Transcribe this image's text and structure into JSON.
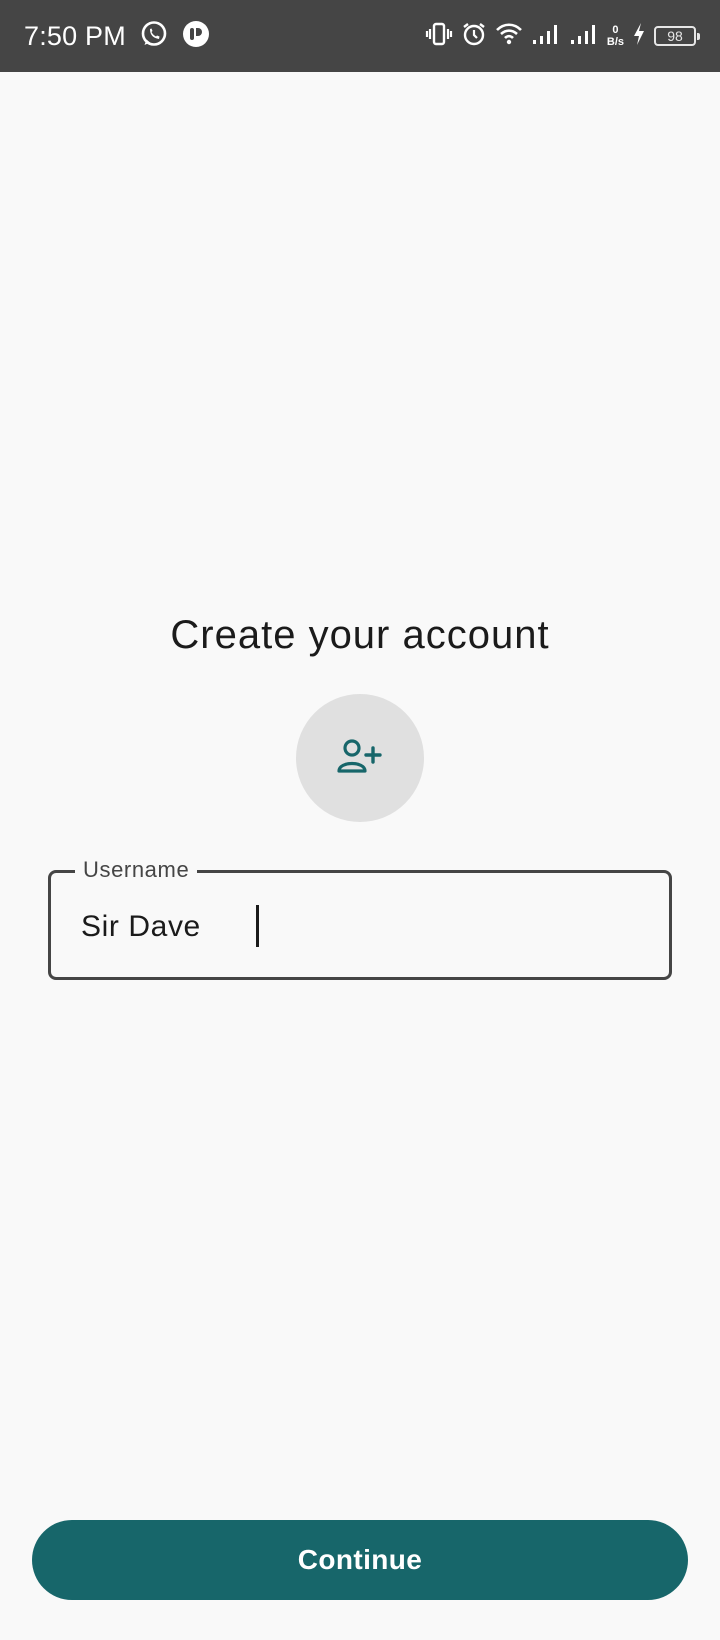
{
  "status_bar": {
    "time": "7:50 PM",
    "net_speed_value": "0",
    "net_speed_unit": "B/s",
    "battery_level": "98",
    "icons": [
      "whatsapp-icon",
      "app-notification-icon",
      "vibrate-icon",
      "alarm-icon",
      "wifi-icon",
      "signal-icon",
      "signal-icon",
      "charging-icon",
      "battery-icon"
    ]
  },
  "main": {
    "title": "Create your account",
    "avatar_icon": "add-person-icon",
    "username_field": {
      "label": "Username",
      "value": "Sir Dave"
    },
    "continue_label": "Continue"
  },
  "colors": {
    "primary": "#17666a",
    "status_bar_bg": "#454545",
    "background": "#f9f9f9",
    "avatar_bg": "#e0e0e0"
  }
}
